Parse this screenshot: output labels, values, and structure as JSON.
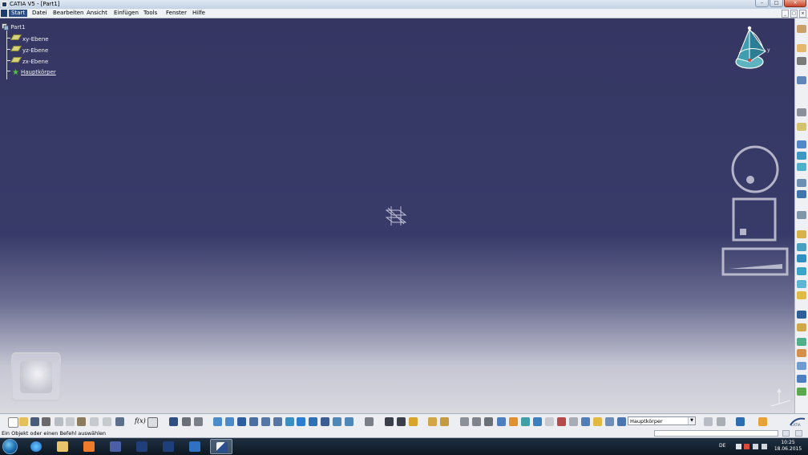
{
  "window": {
    "title": "CATIA V5 - [Part1]",
    "controls": [
      "–",
      "□",
      "×"
    ]
  },
  "menubar": {
    "items": [
      "Start",
      "Datei",
      "Bearbeiten",
      "Ansicht",
      "Einfügen",
      "Tools",
      "Fenster",
      "Hilfe"
    ],
    "active_item": "Start",
    "doc_controls": [
      "_",
      "□",
      "×"
    ]
  },
  "spec_tree": {
    "root": "Part1",
    "children": [
      {
        "label": "xy-Ebene",
        "icon": "plane-icon"
      },
      {
        "label": "yz-Ebene",
        "icon": "plane-icon"
      },
      {
        "label": "zx-Ebene",
        "icon": "plane-icon"
      },
      {
        "label": "Hauptkörper",
        "icon": "part-body-icon",
        "underlined": true
      }
    ]
  },
  "compass": {
    "axis_y": "y"
  },
  "toolbar_bottom": {
    "fx_label": "f(x)",
    "current_body": "Hauptkörper"
  },
  "statusbar": {
    "message": "Ein Objekt oder einen Befehl auswählen"
  },
  "taskbar": {
    "apps": [
      "internet-explorer-icon",
      "explorer-icon",
      "media-player-icon",
      "save-icon",
      "catia-icon",
      "catia-icon-2",
      "outlook-icon",
      "catia-window-icon"
    ],
    "active_app": "catia-window-icon",
    "language": "DE",
    "time": "10:25",
    "date": "18.06.2015"
  },
  "colors": {
    "background_top": "#353662",
    "background_bottom": "#d9d9e0",
    "accent": "#2b4f86",
    "tree_text": "#f0f0f4"
  }
}
